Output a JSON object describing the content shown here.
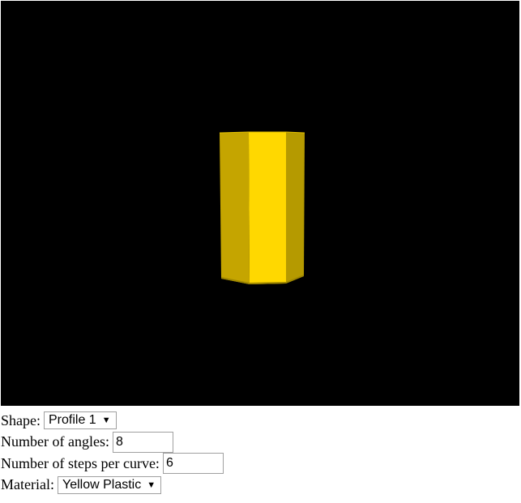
{
  "viewport": {
    "background_color": "#000000",
    "object": {
      "name": "yellow-extruded-prism",
      "colors": {
        "front": "#FFD800",
        "left": "#C5A500",
        "right": "#B59A00",
        "top": "#E8C400",
        "bottom_edge": "#9E8600"
      }
    }
  },
  "controls": {
    "shape": {
      "label": "Shape:",
      "value": "Profile 1"
    },
    "angles": {
      "label": "Number of angles:",
      "value": "8"
    },
    "steps": {
      "label": "Number of steps per curve:",
      "value": "6"
    },
    "material": {
      "label": "Material:",
      "value": "Yellow Plastic"
    }
  }
}
